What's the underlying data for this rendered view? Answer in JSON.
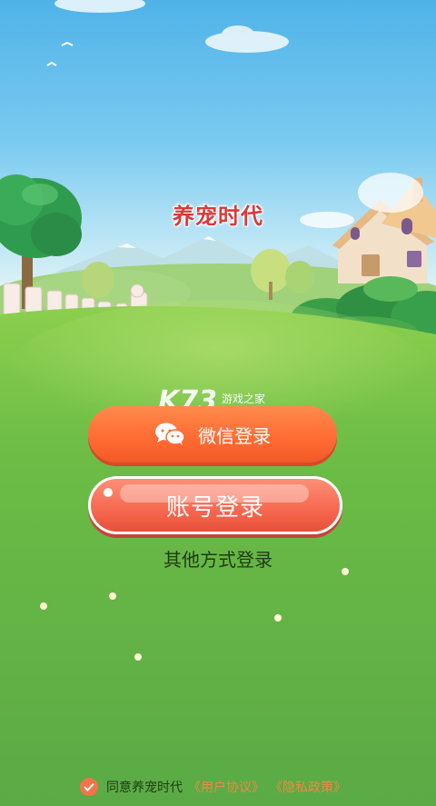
{
  "app": {
    "title": "养宠时代"
  },
  "watermark": {
    "logo": "K73",
    "text": "游戏之家"
  },
  "login": {
    "wechat_label": "微信登录",
    "account_label": "账号登录",
    "other_label": "其他方式登录"
  },
  "agreement": {
    "text": "同意养宠时代",
    "user_agreement": "《用户协议》",
    "privacy_policy": "《隐私政策》",
    "checked": true
  },
  "icons": {
    "wechat": "wechat-icon",
    "check": "check-icon"
  },
  "colors": {
    "title": "#d93a3a",
    "primary_button": "#ff6a32",
    "account_button": "#f4624a",
    "grass": "#67b84a",
    "link": "#f08a3e"
  }
}
